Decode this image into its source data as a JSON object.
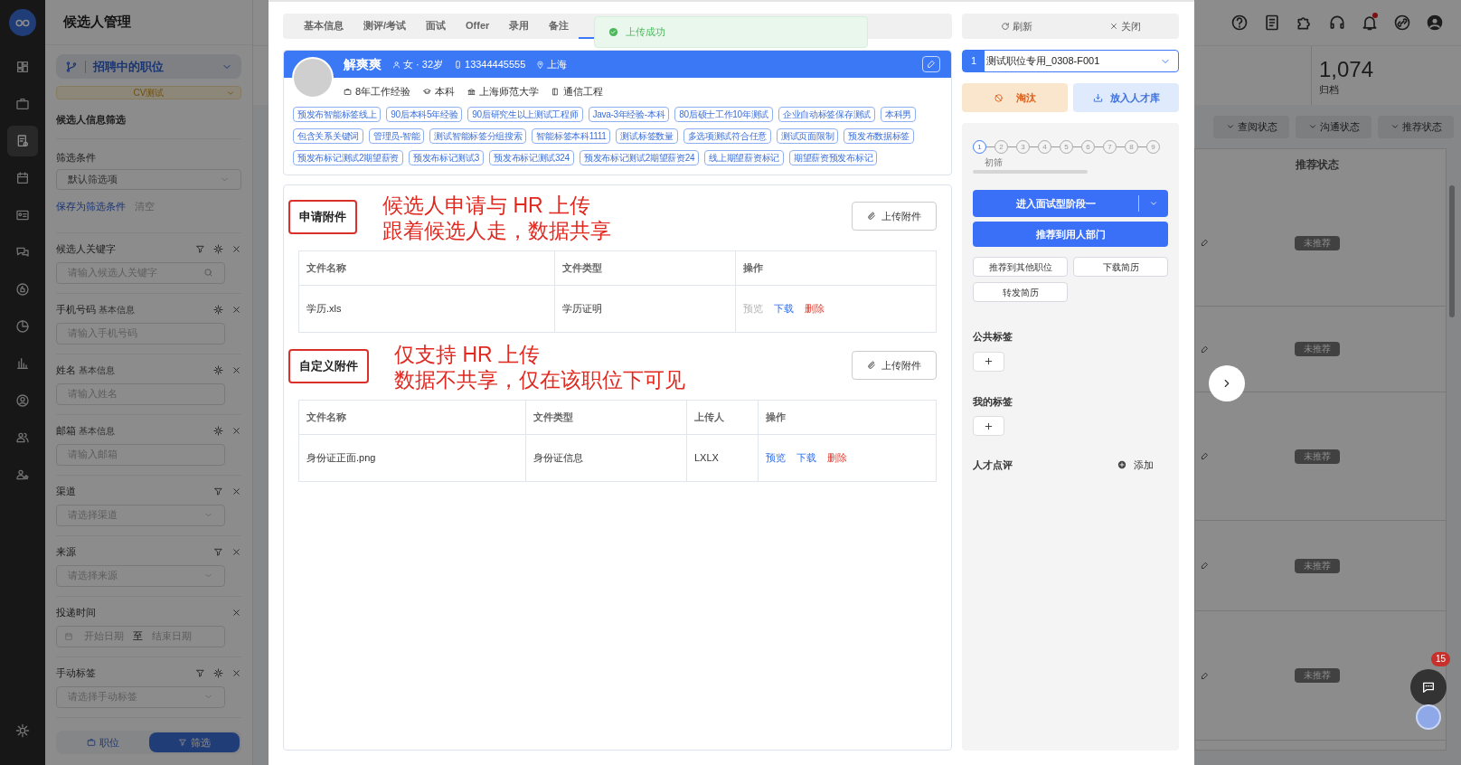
{
  "rail": {
    "items": [
      {
        "kind": "dashboard",
        "selected": false
      },
      {
        "kind": "briefcase",
        "selected": false
      },
      {
        "kind": "resume",
        "selected": true
      },
      {
        "kind": "calendar",
        "selected": false
      },
      {
        "kind": "id-card",
        "selected": false
      },
      {
        "kind": "chat",
        "selected": false
      },
      {
        "kind": "thumb",
        "selected": false
      },
      {
        "kind": "pie",
        "selected": false
      },
      {
        "kind": "bars",
        "selected": false
      },
      {
        "kind": "person-circle",
        "selected": false
      },
      {
        "kind": "people",
        "selected": false
      },
      {
        "kind": "people-star",
        "selected": false
      }
    ]
  },
  "filter_panel": {
    "title": "候选人管理",
    "position_select": "招聘中的职位",
    "job_badge": "CV测试",
    "section_title": "候选人信息筛选",
    "conditions": {
      "label": "筛选条件",
      "value": "默认筛选项",
      "save_link": "保存为筛选条件",
      "clear_link": "清空"
    },
    "filters": [
      {
        "label": "候选人关键字",
        "filter": true,
        "settings": true,
        "field": {
          "kind": "search",
          "placeholder": "请输入候选人关键字"
        }
      },
      {
        "label": "手机号码",
        "sublabel": "基本信息",
        "filter": false,
        "settings": true,
        "field": {
          "kind": "text",
          "placeholder": "请输入手机号码"
        }
      },
      {
        "label": "姓名",
        "sublabel": "基本信息",
        "filter": false,
        "settings": true,
        "field": {
          "kind": "text",
          "placeholder": "请输入姓名"
        }
      },
      {
        "label": "邮箱",
        "sublabel": "基本信息",
        "filter": false,
        "settings": true,
        "field": {
          "kind": "text",
          "placeholder": "请输入邮箱"
        }
      },
      {
        "label": "渠道",
        "filter": true,
        "settings": false,
        "field": {
          "kind": "select",
          "placeholder": "请选择渠道"
        }
      },
      {
        "label": "来源",
        "filter": true,
        "settings": false,
        "field": {
          "kind": "select",
          "placeholder": "请选择来源"
        }
      },
      {
        "label": "投递时间",
        "filter": false,
        "settings": false,
        "field": {
          "kind": "date_range",
          "start_placeholder": "开始日期",
          "separator": "至",
          "end_placeholder": "结束日期"
        }
      },
      {
        "label": "手动标签",
        "filter": true,
        "settings": true,
        "field": {
          "kind": "select",
          "placeholder": "请选择手动标签"
        }
      }
    ],
    "bottom_tabs": [
      {
        "label": "职位",
        "selected": false
      },
      {
        "label": "筛选",
        "selected": true
      }
    ]
  },
  "modal": {
    "tabs": [
      {
        "label": "基本信息",
        "selected": false
      },
      {
        "label": "测评/考试",
        "selected": false
      },
      {
        "label": "面试",
        "selected": false
      },
      {
        "label": "Offer",
        "selected": false
      },
      {
        "label": "录用",
        "selected": false
      },
      {
        "label": "备注",
        "selected": false
      },
      {
        "selected": true
      }
    ],
    "toast": {
      "text": "上传成功"
    },
    "candidate": {
      "name": "解爽爽",
      "gender_age": "女 · 32岁",
      "phone": "13344445555",
      "city": "上海",
      "experience": "8年工作经验",
      "degree": "本科",
      "school": "上海师范大学",
      "major": "通信工程",
      "tags": [
        "预发布智能标签线上",
        "90后本科5年经验",
        "90后研究生以上测试工程师",
        "Java-3年经验-本科",
        "80后硕士工作10年测试",
        "企业自动标签保存测试",
        "本科男",
        "包含关系关键词",
        "管理员-智能",
        "测试智能标签分组搜索",
        "智能标签本科1111",
        "测试标签数量",
        "多选项测试符合任意",
        "测试页面限制",
        "预发布数据标签",
        "预发布标记测试2期望薪资",
        "预发布标记测试3",
        "预发布标记测试324",
        "预发布标记测试2期望薪资24",
        "线上期望薪资标记",
        "期望薪资预发布标记"
      ]
    },
    "attachment_sections": [
      {
        "title": "申请附件",
        "note_lines": [
          "候选人申请与 HR 上传",
          "跟着候选人走，数据共享"
        ],
        "upload_label": "上传附件",
        "columns": [
          "文件名称",
          "文件类型",
          "操作"
        ],
        "rows": [
          {
            "cells": [
              "学历.xls",
              "学历证明"
            ],
            "actions": [
              {
                "kind": "preview",
                "label": "预览",
                "disabled": true
              },
              {
                "kind": "download",
                "label": "下载",
                "disabled": false
              },
              {
                "kind": "delete",
                "label": "删除",
                "disabled": false
              }
            ]
          }
        ]
      },
      {
        "title": "自定义附件",
        "note_lines": [
          "仅支持 HR 上传",
          "数据不共享，仅在该职位下可见"
        ],
        "upload_label": "上传附件",
        "columns": [
          "文件名称",
          "文件类型",
          "上传人",
          "操作"
        ],
        "rows": [
          {
            "cells": [
              "身份证正面.png",
              "身份证信息",
              "LXLX"
            ],
            "actions": [
              {
                "kind": "preview",
                "label": "预览",
                "disabled": false
              },
              {
                "kind": "download",
                "label": "下载",
                "disabled": false
              },
              {
                "kind": "delete",
                "label": "删除",
                "disabled": false
              }
            ]
          }
        ]
      }
    ],
    "side": {
      "refresh": "刷新",
      "close": "关闭",
      "position": {
        "index": "1",
        "value": "测试职位专用_0308-F001"
      },
      "reject": "淘汰",
      "talent_pool": "放入人才库",
      "steps": [
        {
          "label": "1",
          "selected": true,
          "caption": "初筛"
        },
        {
          "label": "2",
          "selected": false
        },
        {
          "label": "3",
          "selected": false
        },
        {
          "label": "4",
          "selected": false
        },
        {
          "label": "5",
          "selected": false
        },
        {
          "label": "6",
          "selected": false
        },
        {
          "label": "7",
          "selected": false
        },
        {
          "label": "8",
          "selected": false
        },
        {
          "label": "9",
          "selected": false
        }
      ],
      "primary_actions": [
        "进入面试型阶段一",
        "推荐到用人部门"
      ],
      "secondary_actions": [
        "推荐到其他职位",
        "下载简历",
        "转发简历"
      ],
      "public_tags_label": "公共标签",
      "my_tags_label": "我的标签",
      "review_label": "人才点评",
      "review_add": "添加"
    }
  },
  "background": {
    "bell_unread": true,
    "count": "1,074",
    "count_label": "归档",
    "filter_buttons": [
      "查阅状态",
      "沟通状态",
      "推荐状态"
    ],
    "column_header": "推荐状态",
    "row_badges": [
      "未推荐",
      "未推荐",
      "未推荐",
      "未推荐",
      "未推荐"
    ],
    "chat_badge": "15"
  }
}
